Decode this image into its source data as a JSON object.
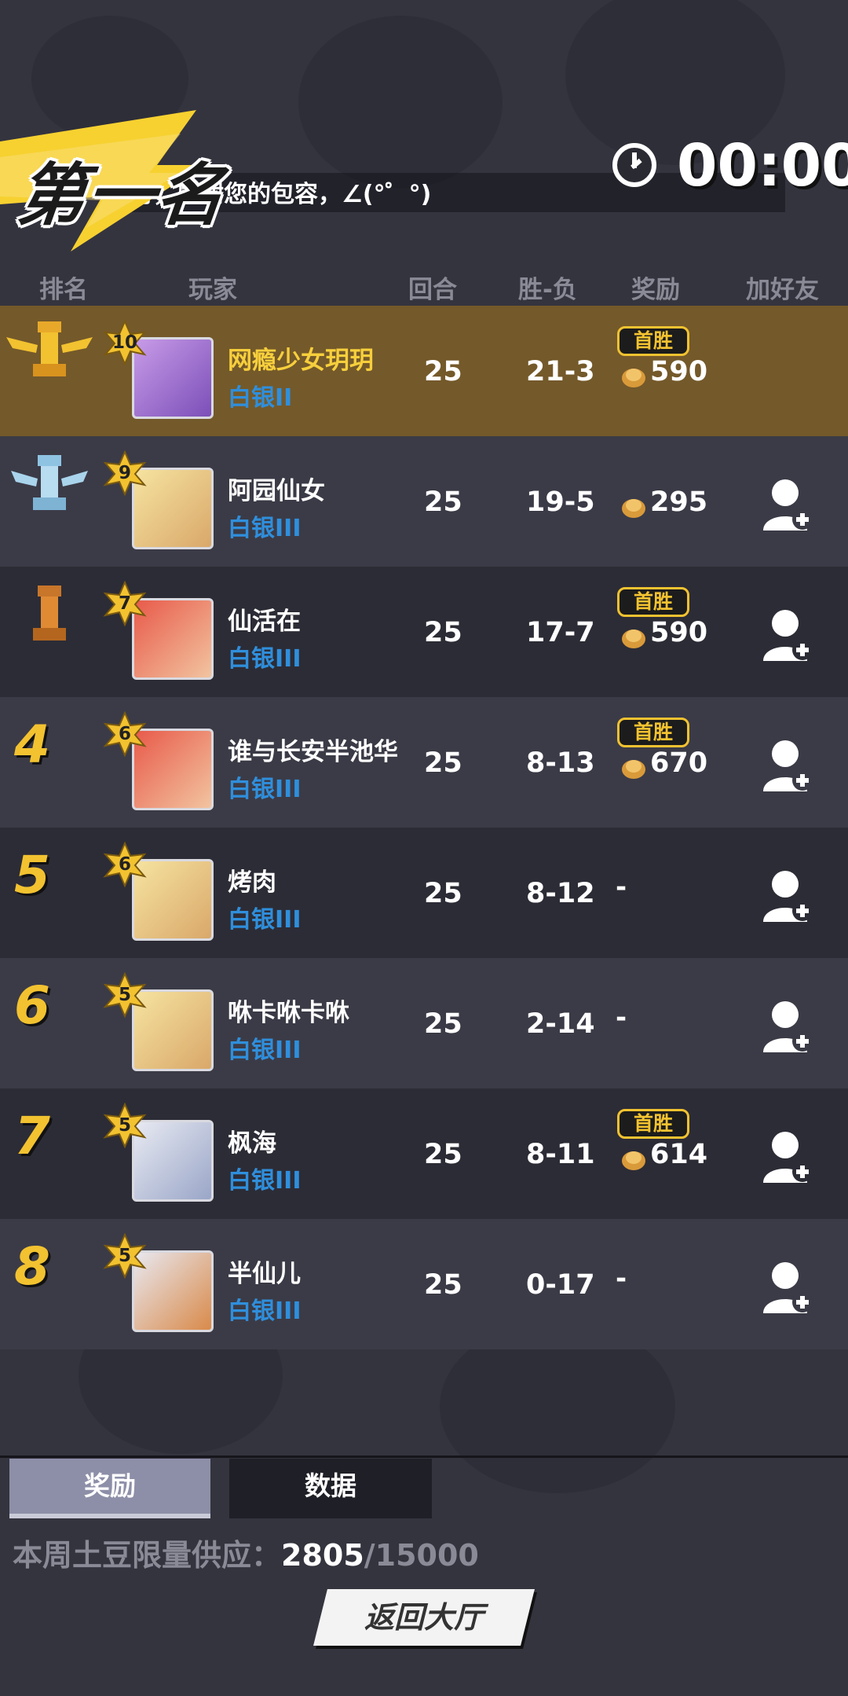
{
  "header": {
    "placement": "第一名",
    "ticker": "时，感谢您的包容，∠(°゜°)",
    "timer": "00:00"
  },
  "columns": [
    "排名",
    "玩家",
    "回合",
    "胜-负",
    "奖励",
    "加好友"
  ],
  "players": [
    {
      "rank": "1",
      "level": "10",
      "name": "网瘾少女玥玥",
      "tier": "白银II",
      "rounds": "25",
      "score": "21-3",
      "first_win": "首胜",
      "reward": "590",
      "trophy": "gold"
    },
    {
      "rank": "2",
      "level": "9",
      "name": "阿园仙女",
      "tier": "白银III",
      "rounds": "25",
      "score": "19-5",
      "first_win": "",
      "reward": "295",
      "trophy": "silver"
    },
    {
      "rank": "3",
      "level": "7",
      "name": "仙活在",
      "tier": "白银III",
      "rounds": "25",
      "score": "17-7",
      "first_win": "首胜",
      "reward": "590",
      "trophy": "bronze"
    },
    {
      "rank": "4",
      "level": "6",
      "name": "谁与长安半池华",
      "tier": "白银III",
      "rounds": "25",
      "score": "8-13",
      "first_win": "首胜",
      "reward": "670",
      "trophy": ""
    },
    {
      "rank": "5",
      "level": "6",
      "name": "烤肉",
      "tier": "白银III",
      "rounds": "25",
      "score": "8-12",
      "first_win": "",
      "reward": "-",
      "trophy": ""
    },
    {
      "rank": "6",
      "level": "5",
      "name": "咻卡咻卡咻",
      "tier": "白银III",
      "rounds": "25",
      "score": "2-14",
      "first_win": "",
      "reward": "-",
      "trophy": ""
    },
    {
      "rank": "7",
      "level": "5",
      "name": "枫海",
      "tier": "白银III",
      "rounds": "25",
      "score": "8-11",
      "first_win": "首胜",
      "reward": "614",
      "trophy": ""
    },
    {
      "rank": "8",
      "level": "5",
      "name": "半仙儿",
      "tier": "白银III",
      "rounds": "25",
      "score": "0-17",
      "first_win": "",
      "reward": "-",
      "trophy": ""
    }
  ],
  "tabs": {
    "rewards": "奖励",
    "data": "数据"
  },
  "supply": {
    "label": "本周土豆限量供应：",
    "current": "2805",
    "max": "/15000"
  },
  "back_button": "返回大厅",
  "colors": {
    "gold": "#f2c230",
    "tier_blue": "#2f8fdc",
    "first_row": "#74592a"
  }
}
